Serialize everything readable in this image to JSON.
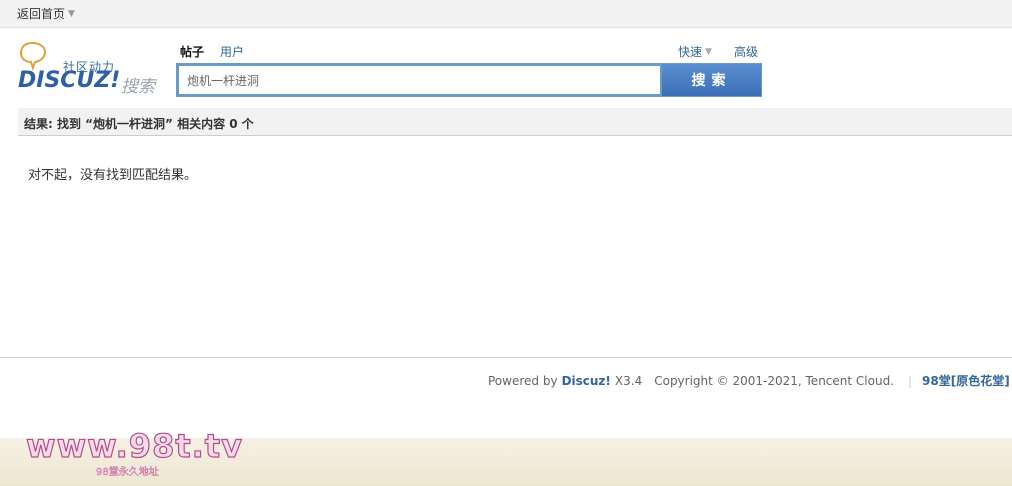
{
  "topbar": {
    "home_label": "返回首页"
  },
  "logo": {
    "slogan": "社区动力",
    "brand": "DISCUZ!",
    "sub": "搜索"
  },
  "search": {
    "tabs": [
      {
        "label": "帖子",
        "active": true
      },
      {
        "label": "用户",
        "active": false
      }
    ],
    "quick_label": "快速",
    "advanced_label": "高级",
    "value": "炮机一杆进洞",
    "button_label": "搜索"
  },
  "result": {
    "summary": "结果: 找到 “炮机一杆进洞” 相关内容 0 个",
    "empty_message": "对不起，没有找到匹配结果。"
  },
  "footer": {
    "powered_by": "Powered by",
    "product": "Discuz!",
    "version": "X3.4",
    "copyright": "Copyright © 2001-2021, Tencent Cloud.",
    "separator": "|",
    "site_name": "98堂[原色花堂]"
  },
  "watermark": {
    "url": "www.98t.tv",
    "caption": "98堂永久地址"
  },
  "colors": {
    "accent": "#336699",
    "search_button": "#4a7ec4"
  }
}
